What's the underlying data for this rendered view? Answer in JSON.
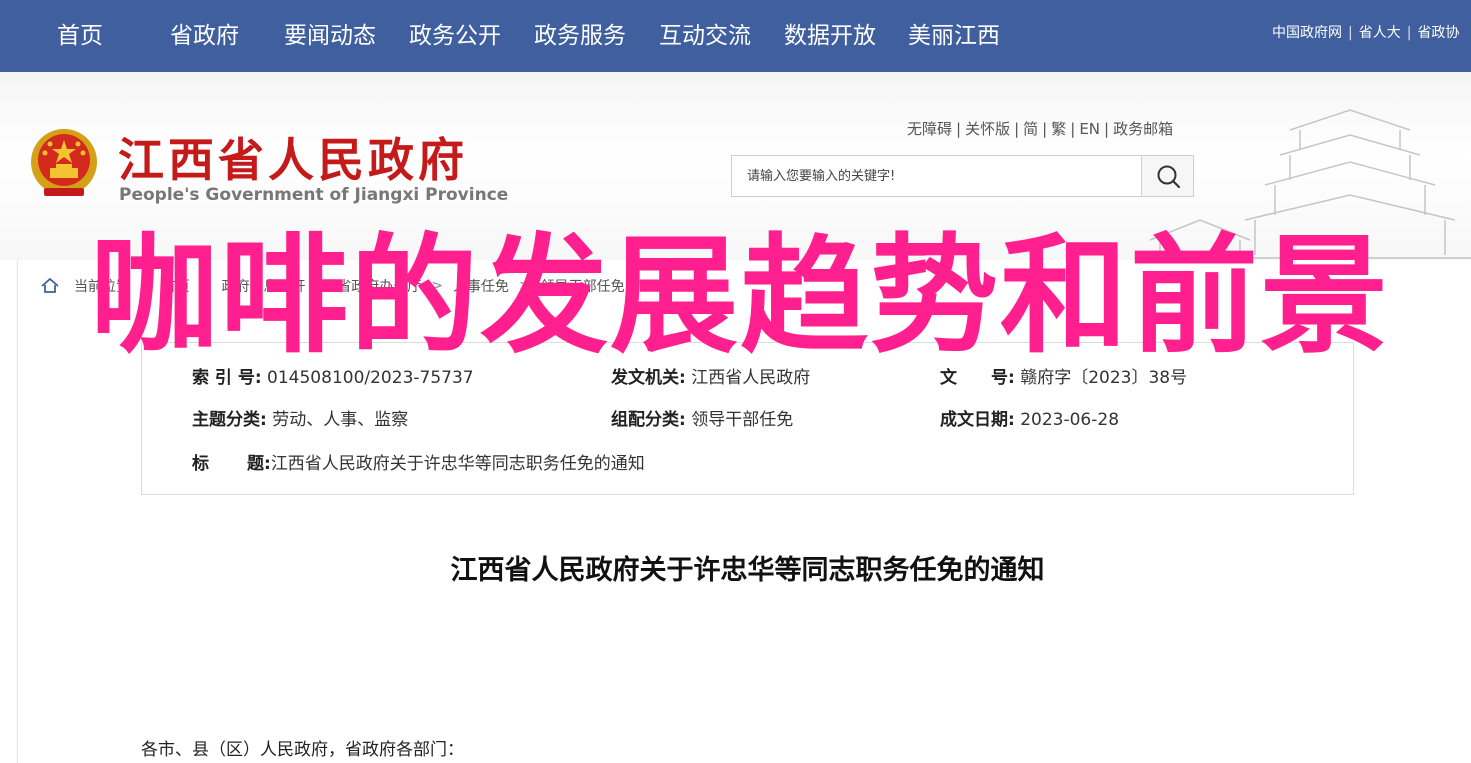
{
  "topnav": {
    "items": [
      "首页",
      "省政府",
      "要闻动态",
      "政务公开",
      "政务服务",
      "互动交流",
      "数据开放",
      "美丽江西"
    ],
    "right_links": [
      "中国政府网",
      "省人大",
      "省政协"
    ]
  },
  "header": {
    "site_title": "江西省人民政府",
    "site_subtitle": "People's Government of Jiangxi Province",
    "util_links": [
      "无障碍",
      "关怀版",
      "简",
      "繁",
      "EN",
      "政务邮箱"
    ],
    "search_placeholder": "请输入您要输入的关键字!",
    "emblem_icon": "national-emblem-icon",
    "search_icon": "search-icon"
  },
  "breadcrumb": {
    "home_icon": "home-icon",
    "items": [
      "当前位置",
      "首页",
      "政府信息公开",
      "省政府办公厅",
      "人事任免",
      "领导干部任免"
    ]
  },
  "meta": {
    "index_label": "索 引 号:",
    "index_value": "014508100/2023-75737",
    "issuer_label": "发文机关:",
    "issuer_value": "江西省人民政府",
    "docno_label": "文　　号:",
    "docno_value": "赣府字〔2023〕38号",
    "topic_label": "主题分类:",
    "topic_value": "劳动、人事、监察",
    "category_label": "组配分类:",
    "category_value": "领导干部任免",
    "date_label": "成文日期:",
    "date_value": "2023-06-28",
    "title_label_a": "标",
    "title_label_b": "题:",
    "title_value": "江西省人民政府关于许忠华等同志职务任免的通知"
  },
  "article": {
    "title": "江西省人民政府关于许忠华等同志职务任免的通知",
    "salutation": "各市、县（区）人民政府，省政府各部门："
  },
  "overlay": {
    "text": "咖啡的发展趋势和前景",
    "color": "#ff1f8e"
  },
  "colors": {
    "nav_bg": "#3f5f9e",
    "brand_red": "#c41a1a"
  }
}
